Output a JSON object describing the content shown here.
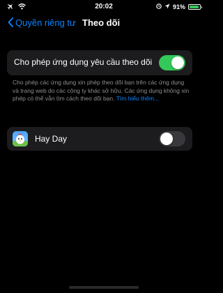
{
  "status_bar": {
    "time": "20:02",
    "battery_percent": "91%",
    "battery_level": 0.91,
    "left_icons": [
      "airplane-icon",
      "wifi-icon"
    ],
    "right_icons": [
      "alarm-icon",
      "location-icon",
      "battery-icon"
    ]
  },
  "nav": {
    "back_label": "Quyền riêng tư",
    "title": "Theo dõi"
  },
  "allow_tracking": {
    "label": "Cho phép ứng dụng yêu cầu theo dõi",
    "enabled": true
  },
  "footnote": {
    "text": "Cho phép các ứng dụng xin phép theo dõi bạn trên các ứng dụng và trang web do các công ty khác sở hữu. Các ứng dụng không xin phép có thể vẫn tìm cách theo dõi bạn.",
    "link": "Tìm hiểu thêm..."
  },
  "apps": [
    {
      "name": "Hay Day",
      "icon": "hay-day-app-icon",
      "enabled": false
    }
  ],
  "colors": {
    "background": "#000000",
    "group_background": "#1c1c1e",
    "accent": "#0a84ff",
    "switch_on": "#34c759",
    "switch_off": "#39393d",
    "secondary_text": "#8e8e93"
  }
}
